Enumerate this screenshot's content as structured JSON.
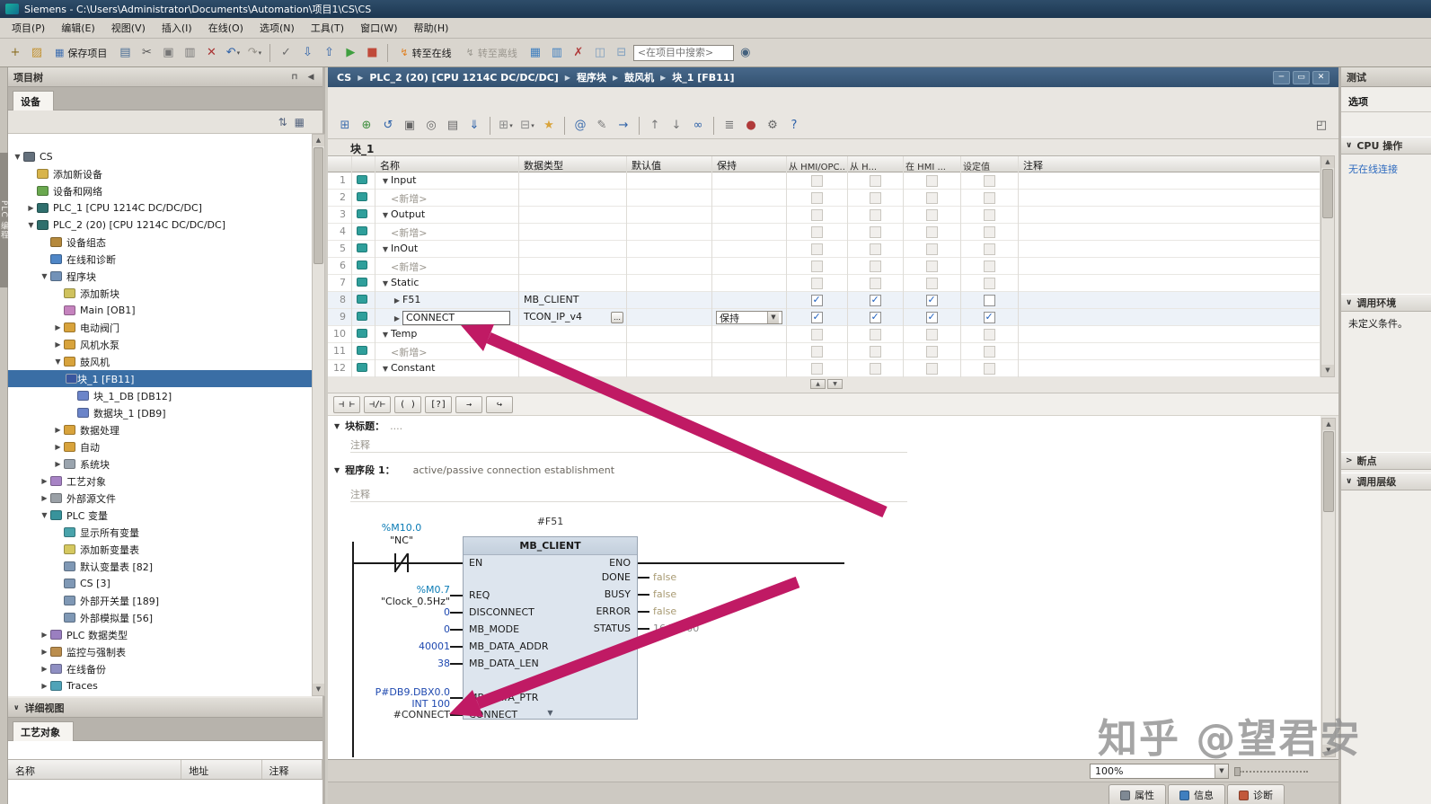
{
  "titlebar": {
    "text": "Siemens  -  C:\\Users\\Administrator\\Documents\\Automation\\项目1\\CS\\CS"
  },
  "menubar": [
    "项目(P)",
    "编辑(E)",
    "视图(V)",
    "插入(I)",
    "在线(O)",
    "选项(N)",
    "工具(T)",
    "窗口(W)",
    "帮助(H)"
  ],
  "toolbar": {
    "search_placeholder": "<在项目中搜索>",
    "groups": [
      {
        "type": "icons",
        "items": [
          {
            "name": "new-project-icon",
            "glyph": "+",
            "fg": "#8a6d1f"
          },
          {
            "name": "open-project-icon",
            "glyph": "▨",
            "fg": "#c29231"
          }
        ]
      },
      {
        "type": "text",
        "name": "save-project-button",
        "glyph": "▦",
        "fg": "#3d6eb0",
        "label": "保存项目"
      },
      {
        "type": "icons",
        "items": [
          {
            "name": "print-icon",
            "glyph": "▤",
            "fg": "#4a6e96"
          },
          {
            "name": "cut-icon",
            "glyph": "✂",
            "fg": "#555555"
          },
          {
            "name": "copy-icon",
            "glyph": "▣",
            "fg": "#777777"
          },
          {
            "name": "paste-icon",
            "glyph": "▥",
            "fg": "#777777"
          },
          {
            "name": "delete-icon",
            "glyph": "✕",
            "fg": "#aa3333"
          },
          {
            "name": "undo-icon",
            "glyph": "↶",
            "fg": "#2d61a8",
            "caret": true
          },
          {
            "name": "redo-icon",
            "glyph": "↷",
            "fg": "#98948c",
            "caret": true
          }
        ]
      },
      {
        "type": "sep"
      },
      {
        "type": "icons",
        "items": [
          {
            "name": "compile-icon",
            "glyph": "✓",
            "fg": "#6b6b6b"
          },
          {
            "name": "download-icon",
            "glyph": "⇩",
            "fg": "#2d61a8"
          },
          {
            "name": "upload-icon",
            "glyph": "⇧",
            "fg": "#2d61a8"
          },
          {
            "name": "start-cpu-icon",
            "glyph": "▶",
            "fg": "#3f9f3f"
          },
          {
            "name": "stop-cpu-icon",
            "glyph": "■",
            "fg": "#c04a3a"
          }
        ]
      },
      {
        "type": "sep"
      },
      {
        "type": "text",
        "name": "go-online-button",
        "glyph": "↯",
        "fg": "#e07f1f",
        "label": "转至在线"
      },
      {
        "type": "text",
        "name": "go-offline-button",
        "glyph": "↯",
        "fg": "#9a978f",
        "label": "转至离线",
        "dim": true
      },
      {
        "type": "icons",
        "items": [
          {
            "name": "accessible-devices-icon",
            "glyph": "▦",
            "fg": "#3f7fbf"
          },
          {
            "name": "start-search-icon",
            "glyph": "▥",
            "fg": "#3f7fbf"
          },
          {
            "name": "cross-reference-icon",
            "glyph": "✗",
            "fg": "#b03a3a"
          },
          {
            "name": "split-horizontal-icon",
            "glyph": "◫",
            "fg": "#7f9fbf"
          },
          {
            "name": "split-vertical-icon",
            "glyph": "⊟",
            "fg": "#7f9fbf"
          }
        ]
      },
      {
        "type": "search"
      },
      {
        "type": "icons",
        "items": [
          {
            "name": "project-library-icon",
            "glyph": "◉",
            "fg": "#44617e"
          }
        ]
      }
    ]
  },
  "side_strip": {
    "label": "PLC 编程"
  },
  "project_tree": {
    "title": "项目树",
    "devices_tab": "设备",
    "tools": [
      {
        "name": "sort-icon",
        "glyph": "⇅"
      },
      {
        "name": "view-options-icon",
        "glyph": "▦"
      }
    ],
    "header_icons": [
      {
        "name": "pin-panel-icon",
        "glyph": "⊓"
      },
      {
        "name": "collapse-panel-icon",
        "glyph": "◀"
      }
    ],
    "items": [
      {
        "id": "cs",
        "label": "CS",
        "level": 0,
        "expand": "open",
        "icon": "project"
      },
      {
        "id": "add-new-device",
        "label": "添加新设备",
        "level": 1,
        "icon": "add-device"
      },
      {
        "id": "devices-networks",
        "label": "设备和网络",
        "level": 1,
        "icon": "network"
      },
      {
        "id": "plc1",
        "label": "PLC_1 [CPU 1214C DC/DC/DC]",
        "level": 1,
        "expand": "closed",
        "icon": "plc"
      },
      {
        "id": "plc2",
        "label": "PLC_2 (20)  [CPU 1214C DC/DC/DC]",
        "level": 1,
        "expand": "open",
        "icon": "plc"
      },
      {
        "id": "device-configuration",
        "label": "设备组态",
        "level": 2,
        "icon": "device-config"
      },
      {
        "id": "online-diagnostics",
        "label": "在线和诊断",
        "level": 2,
        "icon": "online-diag"
      },
      {
        "id": "program-blocks",
        "label": "程序块",
        "level": 2,
        "expand": "open",
        "icon": "folder-blocks"
      },
      {
        "id": "add-new-block",
        "label": "添加新块",
        "level": 3,
        "icon": "add-block"
      },
      {
        "id": "main-ob1",
        "label": "Main [OB1]",
        "level": 3,
        "icon": "ob-block"
      },
      {
        "id": "group-electric-valve",
        "label": "电动阀门",
        "level": 3,
        "expand": "closed",
        "icon": "folder-group"
      },
      {
        "id": "group-fan-pump",
        "label": "风机水泵",
        "level": 3,
        "expand": "closed",
        "icon": "folder-group"
      },
      {
        "id": "group-blower",
        "label": "鼓风机",
        "level": 3,
        "expand": "open",
        "icon": "folder-group"
      },
      {
        "id": "block-1-fb11",
        "label": "块_1 [FB11]",
        "level": 4,
        "icon": "fb-block",
        "selected": true
      },
      {
        "id": "block-1-db12",
        "label": "块_1_DB [DB12]",
        "level": 4,
        "icon": "db-block"
      },
      {
        "id": "data-block-1-db9",
        "label": "数据块_1 [DB9]",
        "level": 4,
        "icon": "db-block"
      },
      {
        "id": "group-data-processing",
        "label": "数据处理",
        "level": 3,
        "expand": "closed",
        "icon": "folder-group"
      },
      {
        "id": "group-auto",
        "label": "自动",
        "level": 3,
        "expand": "closed",
        "icon": "folder-group"
      },
      {
        "id": "system-blocks",
        "label": "系统块",
        "level": 3,
        "expand": "closed",
        "icon": "folder-sys"
      },
      {
        "id": "technology-objects",
        "label": "工艺对象",
        "level": 2,
        "expand": "closed",
        "icon": "tech-object"
      },
      {
        "id": "external-source-files",
        "label": "外部源文件",
        "level": 2,
        "expand": "closed",
        "icon": "ext-source"
      },
      {
        "id": "plc-tags",
        "label": "PLC 变量",
        "level": 2,
        "expand": "open",
        "icon": "plc-tags"
      },
      {
        "id": "show-all-tags",
        "label": "显示所有变量",
        "level": 3,
        "icon": "show-tags"
      },
      {
        "id": "add-new-tag-table",
        "label": "添加新变量表",
        "level": 3,
        "icon": "add-tag-table"
      },
      {
        "id": "default-tag-table",
        "label": "默认变量表 [82]",
        "level": 3,
        "icon": "tag-table"
      },
      {
        "id": "cs-tag-table",
        "label": "CS [3]",
        "level": 3,
        "icon": "tag-table"
      },
      {
        "id": "external-digital",
        "label": "外部开关量 [189]",
        "level": 3,
        "icon": "tag-table"
      },
      {
        "id": "external-analog",
        "label": "外部模拟量 [56]",
        "level": 3,
        "icon": "tag-table"
      },
      {
        "id": "plc-data-types",
        "label": "PLC 数据类型",
        "level": 2,
        "expand": "closed",
        "icon": "data-types"
      },
      {
        "id": "watch-force-tables",
        "label": "监控与强制表",
        "level": 2,
        "expand": "closed",
        "icon": "watch-tables"
      },
      {
        "id": "online-backups",
        "label": "在线备份",
        "level": 2,
        "expand": "closed",
        "icon": "online-backup"
      },
      {
        "id": "traces",
        "label": "Traces",
        "level": 2,
        "expand": "closed",
        "icon": "traces"
      }
    ]
  },
  "detail_view": {
    "title": "详细视图",
    "tab": "工艺对象",
    "columns": [
      "名称",
      "地址",
      "注释"
    ]
  },
  "editor": {
    "breadcrumb": [
      "CS",
      "PLC_2 (20)  [CPU 1214C DC/DC/DC]",
      "程序块",
      "鼓风机",
      "块_1 [FB11]"
    ],
    "window_controls": [
      {
        "name": "minimize-button",
        "glyph": "─"
      },
      {
        "name": "restore-button",
        "glyph": "▭"
      },
      {
        "name": "close-button",
        "glyph": "✕"
      }
    ],
    "block_name": "块_1",
    "toolbar_icons": [
      {
        "name": "insert-row-icon",
        "glyph": "⊞",
        "fg": "#3f6fae"
      },
      {
        "name": "add-row-icon",
        "glyph": "⊕",
        "fg": "#3f8f3f"
      },
      {
        "name": "reset-start-values-icon",
        "glyph": "↺",
        "fg": "#2d61a8"
      },
      {
        "name": "keep-actual-values-icon",
        "glyph": "▣",
        "fg": "#666666"
      },
      {
        "name": "snapshot-icon",
        "glyph": "◎",
        "fg": "#666666"
      },
      {
        "name": "copy-snapshots-icon",
        "glyph": "▤",
        "fg": "#666666"
      },
      {
        "name": "load-without-reinit-icon",
        "glyph": "⇓",
        "fg": "#2d61a8"
      },
      {
        "name": "expand-all-icon",
        "glyph": "⊞",
        "fg": "#8a8a8a",
        "caret": true
      },
      {
        "name": "collapse-all-icon",
        "glyph": "⊟",
        "fg": "#8a8a8a",
        "caret": true
      },
      {
        "name": "favorites-icon",
        "glyph": "★",
        "fg": "#d9a43c"
      },
      {
        "name": "absolute-operands-icon",
        "glyph": "@",
        "fg": "#3f6fae"
      },
      {
        "name": "network-comments-icon",
        "glyph": "✎",
        "fg": "#777777"
      },
      {
        "name": "goto-icon",
        "glyph": "→",
        "fg": "#2d61a8"
      },
      {
        "name": "previous-error-icon",
        "glyph": "↑",
        "fg": "#777777"
      },
      {
        "name": "next-error-icon",
        "glyph": "↓",
        "fg": "#777777"
      },
      {
        "name": "monitor-toggle-icon",
        "glyph": "∞",
        "fg": "#2d61a8"
      },
      {
        "name": "call-structure-icon",
        "glyph": "≣",
        "fg": "#777777"
      },
      {
        "name": "breakpoint-icon",
        "glyph": "●",
        "fg": "#b03a3a"
      },
      {
        "name": "settings-icon",
        "glyph": "⚙",
        "fg": "#666666"
      },
      {
        "name": "help-icon",
        "glyph": "?",
        "fg": "#2d61a8"
      }
    ],
    "maximize_icon": {
      "name": "maximize-editor-icon",
      "glyph": "◰",
      "fg": "#555555"
    },
    "interface": {
      "columns": [
        "名称",
        "数据类型",
        "默认值",
        "保持",
        "从 HMI/OPC..",
        "从 H...",
        "在 HMI ...",
        "设定值",
        "注释"
      ],
      "rows": [
        {
          "num": "1",
          "kind": "section",
          "expand": "open",
          "name": "Input"
        },
        {
          "num": "2",
          "kind": "add",
          "name": "<新增>"
        },
        {
          "num": "3",
          "kind": "section",
          "expand": "open",
          "name": "Output"
        },
        {
          "num": "4",
          "kind": "add",
          "name": "<新增>"
        },
        {
          "num": "5",
          "kind": "section",
          "expand": "open",
          "name": "InOut"
        },
        {
          "num": "6",
          "kind": "add",
          "name": "<新增>"
        },
        {
          "num": "7",
          "kind": "section",
          "expand": "open",
          "name": "Static"
        },
        {
          "num": "8",
          "kind": "var",
          "expand": "closed",
          "name": "F51",
          "type": "MB_CLIENT",
          "checks": [
            1,
            1,
            1,
            0
          ]
        },
        {
          "num": "9",
          "kind": "var",
          "expand": "closed",
          "name": "CONNECT",
          "type": "TCON_IP_v4",
          "type_btn": true,
          "retain": "保持",
          "checks": [
            1,
            1,
            1,
            1
          ],
          "editing": true
        },
        {
          "num": "10",
          "kind": "section",
          "expand": "open",
          "name": "Temp"
        },
        {
          "num": "11",
          "kind": "add",
          "name": "<新增>"
        },
        {
          "num": "12",
          "kind": "section",
          "expand": "open",
          "name": "Constant"
        }
      ]
    },
    "ladder": {
      "toolbar": [
        {
          "name": "no-contact-button",
          "glyph": "⊣ ⊢"
        },
        {
          "name": "nc-contact-button",
          "glyph": "⊣/⊢"
        },
        {
          "name": "coil-button",
          "glyph": "( )"
        },
        {
          "name": "empty-box-button",
          "glyph": "[?]"
        },
        {
          "name": "open-branch-button",
          "glyph": "→"
        },
        {
          "name": "close-branch-button",
          "glyph": "↪"
        }
      ],
      "block_title_label": "块标题：",
      "block_title_value": "....",
      "comment_placeholder": "注释",
      "network_label": "程序段 1：",
      "network_title": "active/passive connection establishment",
      "network_comment": "注释",
      "rung": {
        "ref": "#F51",
        "block_type": "MB_CLIENT",
        "contact": {
          "addr": "%M10.0",
          "tag": "\"NC\""
        },
        "left_pins": [
          {
            "label": "EN"
          },
          {
            "label": "REQ",
            "op1": "%M0.7",
            "op1_cls": "tag",
            "op2": "\"Clock_0.5Hz\"",
            "op2_cls": "sym"
          },
          {
            "label": "DISCONNECT",
            "op1": "0",
            "op1_cls": "const"
          },
          {
            "label": "MB_MODE",
            "op1": "0",
            "op1_cls": "const"
          },
          {
            "label": "MB_DATA_ADDR",
            "op1": "40001",
            "op1_cls": "const"
          },
          {
            "label": "MB_DATA_LEN",
            "op1": "38",
            "op1_cls": "const"
          },
          {
            "label": "MB_DATA_PTR",
            "op1": "P#DB9.DBX0.0",
            "op1_cls": "const",
            "op2": "INT 100",
            "op2_cls": "const"
          },
          {
            "label": "CONNECT",
            "op1": "#CONNECT",
            "op1_cls": "local"
          }
        ],
        "right_pins": [
          {
            "label": "ENO"
          },
          {
            "label": "DONE",
            "value": "false",
            "value_cls": "monitor"
          },
          {
            "label": "BUSY",
            "value": "false",
            "value_cls": "monitor"
          },
          {
            "label": "ERROR",
            "value": "false",
            "value_cls": "monitor"
          },
          {
            "label": "STATUS",
            "value": "16#0000",
            "value_cls": "status"
          }
        ]
      }
    },
    "zoom_value": "100%"
  },
  "test_panel": {
    "title": "测试",
    "options_label": "选项",
    "sections": [
      {
        "id": "cpu-operator-panel",
        "label": "CPU 操作",
        "chevron": "∨",
        "content": "无在线连接",
        "content_kind": "link"
      },
      {
        "id": "call-environment",
        "label": "调用环境",
        "chevron": "∨",
        "content": "未定义条件。",
        "content_kind": "plain"
      },
      {
        "id": "breakpoints",
        "label": "断点",
        "chevron": ">",
        "content": ""
      },
      {
        "id": "call-hierarchy",
        "label": "调用层级",
        "chevron": "∨",
        "content": ""
      }
    ]
  },
  "inspector_tabs": [
    {
      "label": "属性",
      "color": "#7f8994",
      "name": "properties-tab"
    },
    {
      "label": "信息",
      "color": "#3f7fbf",
      "name": "info-tab"
    },
    {
      "label": "诊断",
      "color": "#c2583a",
      "name": "diagnostics-tab"
    }
  ],
  "watermark": "知乎 @望君安",
  "colors": {
    "arrow": "#c01a64",
    "selection": "#3a6ea5",
    "online_blue": "#2f6bbf"
  }
}
